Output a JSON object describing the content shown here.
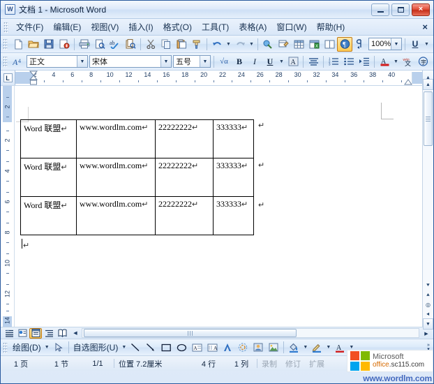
{
  "window": {
    "title": "文档 1 - Microsoft Word",
    "app_icon": "word-document-icon",
    "minimize_label": "最小化",
    "maximize_label": "最大化",
    "close_label": "×"
  },
  "menubar": {
    "items": [
      {
        "label": "文件(F)",
        "name": "menu-file"
      },
      {
        "label": "编辑(E)",
        "name": "menu-edit"
      },
      {
        "label": "视图(V)",
        "name": "menu-view"
      },
      {
        "label": "插入(I)",
        "name": "menu-insert"
      },
      {
        "label": "格式(O)",
        "name": "menu-format"
      },
      {
        "label": "工具(T)",
        "name": "menu-tools"
      },
      {
        "label": "表格(A)",
        "name": "menu-table"
      },
      {
        "label": "窗口(W)",
        "name": "menu-window"
      },
      {
        "label": "帮助(H)",
        "name": "menu-help"
      }
    ],
    "close_document_label": "×"
  },
  "standard_toolbar": {
    "buttons": [
      {
        "name": "new-document-icon",
        "glyph": "🗋"
      },
      {
        "name": "open-folder-icon",
        "glyph": "🗁"
      },
      {
        "name": "save-icon",
        "glyph": "🖫"
      },
      {
        "name": "permission-icon",
        "glyph": "🔒"
      },
      {
        "name": "print-icon",
        "glyph": "🖨"
      },
      {
        "name": "print-preview-icon",
        "glyph": "🔍"
      },
      {
        "name": "spelling-check-icon",
        "glyph": "abc"
      },
      {
        "name": "research-icon",
        "glyph": "📖"
      },
      {
        "name": "cut-scissors-icon",
        "glyph": "✂"
      },
      {
        "name": "copy-icon",
        "glyph": "⧉"
      },
      {
        "name": "paste-icon",
        "glyph": "📋"
      },
      {
        "name": "format-painter-icon",
        "glyph": "🖌"
      },
      {
        "name": "undo-icon",
        "glyph": "↶"
      },
      {
        "name": "redo-icon",
        "glyph": "↷"
      },
      {
        "name": "insert-hyperlink-icon",
        "glyph": "🔗"
      },
      {
        "name": "tables-borders-icon",
        "glyph": "▦"
      },
      {
        "name": "insert-table-icon",
        "glyph": "⊞"
      },
      {
        "name": "insert-excel-sheet-icon",
        "glyph": "⊟"
      },
      {
        "name": "columns-icon",
        "glyph": "◫"
      },
      {
        "name": "show-formatting-marks-icon",
        "glyph": "¶"
      }
    ],
    "zoom": {
      "value": "100%",
      "name": "zoom-combo"
    },
    "underline_label": "U"
  },
  "formatting_toolbar": {
    "style_box": {
      "value": "正文",
      "name": "style-combo"
    },
    "font_box": {
      "value": "宋体",
      "name": "font-combo"
    },
    "size_box": {
      "value": "五号",
      "name": "font-size-combo"
    },
    "bold_label": "B",
    "italic_label": "I",
    "underline_label": "U",
    "buttons": [
      {
        "name": "styles-formatting-icon",
        "glyph": "A"
      },
      {
        "name": "equation-icon",
        "glyph": "√α"
      },
      {
        "name": "character-shading-icon",
        "glyph": "A"
      },
      {
        "name": "align-center-icon",
        "glyph": "≡"
      },
      {
        "name": "numbered-list-icon",
        "glyph": "⒈"
      },
      {
        "name": "bulleted-list-icon",
        "glyph": "•"
      },
      {
        "name": "increase-indent-icon",
        "glyph": "⇥"
      },
      {
        "name": "font-color-icon",
        "glyph": "A"
      },
      {
        "name": "phonetic-guide-icon",
        "glyph": "文"
      },
      {
        "name": "enclose-character-icon",
        "glyph": "㋐"
      }
    ]
  },
  "ruler": {
    "tab_stop_type": "L",
    "horizontal_ticks": [
      2,
      4,
      6,
      8,
      10,
      12,
      14,
      16,
      18,
      20,
      22,
      24,
      26,
      28,
      30,
      32,
      34,
      36,
      38,
      40
    ],
    "vertical_ticks": [
      2,
      2,
      4,
      6,
      8,
      10,
      12,
      14
    ],
    "units": "厘米"
  },
  "document": {
    "table": {
      "rows": 3,
      "columns": 4,
      "paragraph_mark": "↵",
      "cell_mark": "¤",
      "data": [
        [
          "Word 联盟",
          "www.wordlm.com",
          "22222222",
          "333333"
        ],
        [
          "Word 联盟",
          "www.wordlm.com",
          "22222222",
          "333333"
        ],
        [
          "Word 联盟",
          "www.wordlm.com",
          "22222222",
          "333333"
        ]
      ]
    },
    "trailing_paragraph_mark": "↵"
  },
  "view_buttons": [
    {
      "name": "normal-view-button",
      "glyph": "≡",
      "selected": false
    },
    {
      "name": "web-layout-view-button",
      "glyph": "🌐",
      "selected": false
    },
    {
      "name": "print-layout-view-button",
      "glyph": "▤",
      "selected": true
    },
    {
      "name": "outline-view-button",
      "glyph": "⊟",
      "selected": false
    },
    {
      "name": "reading-layout-view-button",
      "glyph": "📖",
      "selected": false
    }
  ],
  "drawing_toolbar": {
    "draw_menu_label": "绘图(D)",
    "autoshapes_label": "自选图形(U)",
    "buttons": [
      {
        "name": "select-objects-arrow-icon",
        "glyph": "↖"
      },
      {
        "name": "line-icon",
        "glyph": "╲"
      },
      {
        "name": "arrow-icon",
        "glyph": "↘"
      },
      {
        "name": "rectangle-icon",
        "glyph": "▭"
      },
      {
        "name": "oval-icon",
        "glyph": "◯"
      },
      {
        "name": "text-box-icon",
        "glyph": "A"
      },
      {
        "name": "vertical-text-box-icon",
        "glyph": "A"
      },
      {
        "name": "insert-wordart-icon",
        "glyph": "◢"
      },
      {
        "name": "insert-diagram-icon",
        "glyph": "❖"
      },
      {
        "name": "insert-clip-art-icon",
        "glyph": "🖼"
      },
      {
        "name": "insert-picture-icon",
        "glyph": "🏞"
      },
      {
        "name": "fill-color-icon",
        "glyph": "🎨"
      },
      {
        "name": "line-color-icon",
        "glyph": "✎"
      },
      {
        "name": "font-color-icon",
        "glyph": "A"
      }
    ]
  },
  "statusbar": {
    "page_label": "1 页",
    "section_label": "1 节",
    "page_of_pages": "1/1",
    "position_label": "位置 7.2厘米",
    "line_label": "4 行",
    "column_label": "1 列",
    "record_label": "录制",
    "revision_label": "修订",
    "extend_label": "扩展"
  },
  "watermark": {
    "brand": "Microsoft",
    "office_prefix": "office",
    "office_domain": ".sc115.com",
    "url": "www.wordlm.com"
  },
  "colors": {
    "titlebar_blue": "#cfe0f6",
    "accent_orange": "#ffcb54",
    "close_red": "#c52f1a",
    "doc_white": "#ffffff"
  }
}
